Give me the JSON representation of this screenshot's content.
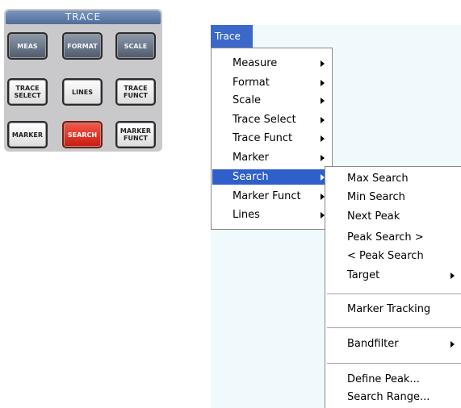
{
  "panel": {
    "title": "TRACE",
    "keys": [
      {
        "label": "MEAS"
      },
      {
        "label": "FORMAT"
      },
      {
        "label": "SCALE"
      },
      {
        "label": "TRACE\nSELECT"
      },
      {
        "label": "LINES"
      },
      {
        "label": "TRACE\nFUNCT"
      },
      {
        "label": "MARKER"
      },
      {
        "label": "SEARCH"
      },
      {
        "label": "MARKER\nFUNCT"
      }
    ]
  },
  "menubar": {
    "title": "Trace"
  },
  "trace_menu": {
    "items": [
      {
        "label": "Measure"
      },
      {
        "label": "Format"
      },
      {
        "label": "Scale"
      },
      {
        "label": "Trace Select"
      },
      {
        "label": "Trace Funct"
      },
      {
        "label": "Marker"
      },
      {
        "label": "Search"
      },
      {
        "label": "Marker Funct"
      },
      {
        "label": "Lines"
      }
    ],
    "selected": "Search"
  },
  "search_submenu": {
    "items": [
      {
        "label": "Max Search"
      },
      {
        "label": "Min Search"
      },
      {
        "label": "Next Peak"
      },
      {
        "label": "Peak Search >"
      },
      {
        "label": "< Peak Search"
      },
      {
        "label": "Target"
      },
      {
        "label": "Marker Tracking"
      },
      {
        "label": "Bandfilter"
      },
      {
        "label": "Define Peak..."
      },
      {
        "label": "Search Range..."
      }
    ]
  }
}
